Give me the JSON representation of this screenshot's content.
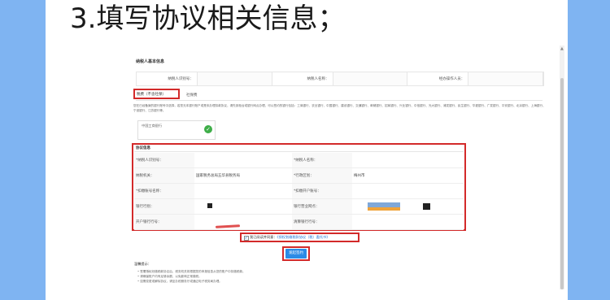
{
  "heading": "3.填写协议相关信息；",
  "basic_info": {
    "title": "纳税人基本信息",
    "fields": [
      "纳税人识别号：",
      "纳税人名称：",
      "经办操作人员："
    ]
  },
  "tabs": {
    "tax": "税费（不含社保）",
    "social": "社保费"
  },
  "paragraph": "您在已经备案的银行账号中选择，若您无本银行账户或是未办理扣款协议，请先到柜台或银行网点办理，可以签约的银行包括：工商银行、农业银行、中国银行、建设银行、交通银行、邮储银行、招商银行、兴业银行、中信银行、光大银行、浦发银行、民生银行、华夏银行、广发银行、平安银行、北京银行、上海银行、宁波银行、江苏银行等。",
  "bank_card": {
    "name": "中国工商银行"
  },
  "protocol": {
    "title": "协议信息",
    "rows": [
      [
        "*纳税人识别号：",
        "",
        "*纳税人名称：",
        ""
      ],
      [
        "纳税机关：",
        "国家税务总局五华县税务局",
        "*行政区划：",
        "梅州市"
      ],
      [
        "*扣缴账号名称：",
        "",
        "*扣缴开户账号：",
        ""
      ],
      [
        "银行行别：",
        "",
        "银行营业网点：",
        ""
      ],
      [
        "开户银行行号：",
        "",
        "清算银行行号：",
        ""
      ]
    ]
  },
  "agree": {
    "prefix": "我已阅读并同意：",
    "link": "《授权划缴税款协议（税）委托书》"
  },
  "sign_button": "发起签约",
  "notice": {
    "title": "温馨提示：",
    "items": [
      "• 签署授权划缴税款协议后，税务机关将根据您的申报信息从您的账户中扣缴税款。",
      "• 请确保账户内有足够余额，以免影响正常缴税。",
      "• 如需变更或解除协议，请至办税服务厅或通过电子税务局办理。"
    ]
  },
  "colors": {
    "highlight": "#d32a2a",
    "primary": "#2b8be6",
    "background": "#7fb4f2"
  }
}
